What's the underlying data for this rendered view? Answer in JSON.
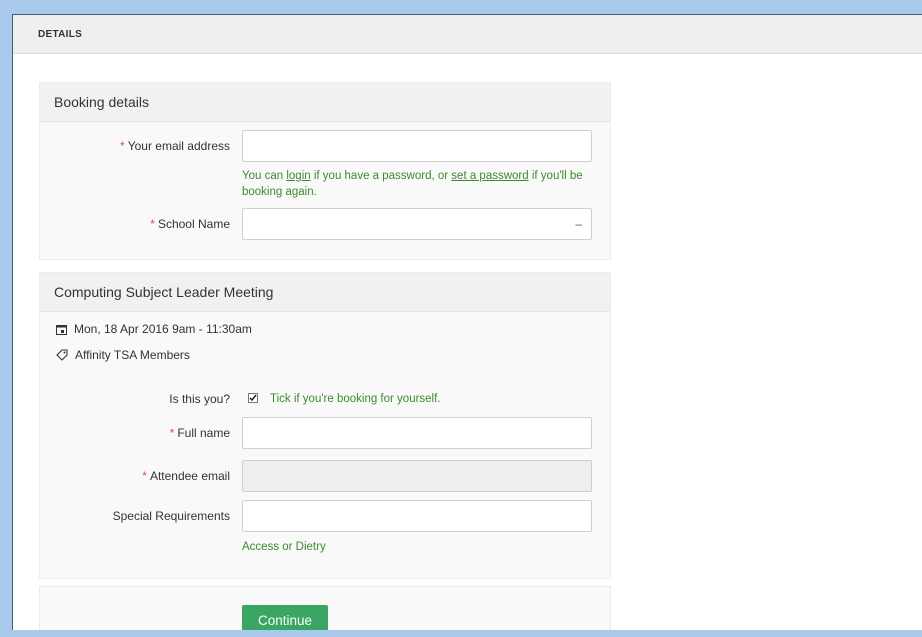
{
  "header": {
    "title": "DETAILS"
  },
  "booking": {
    "title": "Booking details",
    "email_label": "Your email address",
    "email_value": "",
    "help_prefix": "You can ",
    "help_login": "login",
    "help_mid": " if you have a password, or ",
    "help_set_password": "set a password",
    "help_suffix": " if you'll be booking again.",
    "school_label": "School Name",
    "school_value": "",
    "required_mark": "*"
  },
  "event": {
    "title": "Computing Subject Leader Meeting",
    "datetime": "Mon, 18 Apr 2016  9am - 11:30am",
    "ticket": "Affinity TSA Members",
    "is_you_label": "Is this you?",
    "is_you_checked": true,
    "is_you_help": "Tick if you're booking for yourself.",
    "full_name_label": "Full name",
    "full_name_value": "",
    "attendee_email_label": "Attendee email",
    "attendee_email_value": "",
    "special_label": "Special Requirements",
    "special_value": "",
    "special_help": "Access or Dietry"
  },
  "actions": {
    "continue_label": "Continue"
  },
  "colors": {
    "accent_green": "#3aa664",
    "help_green": "#3c8a2e",
    "required_red": "#d9534f",
    "frame_blue": "#a9c9ec"
  }
}
